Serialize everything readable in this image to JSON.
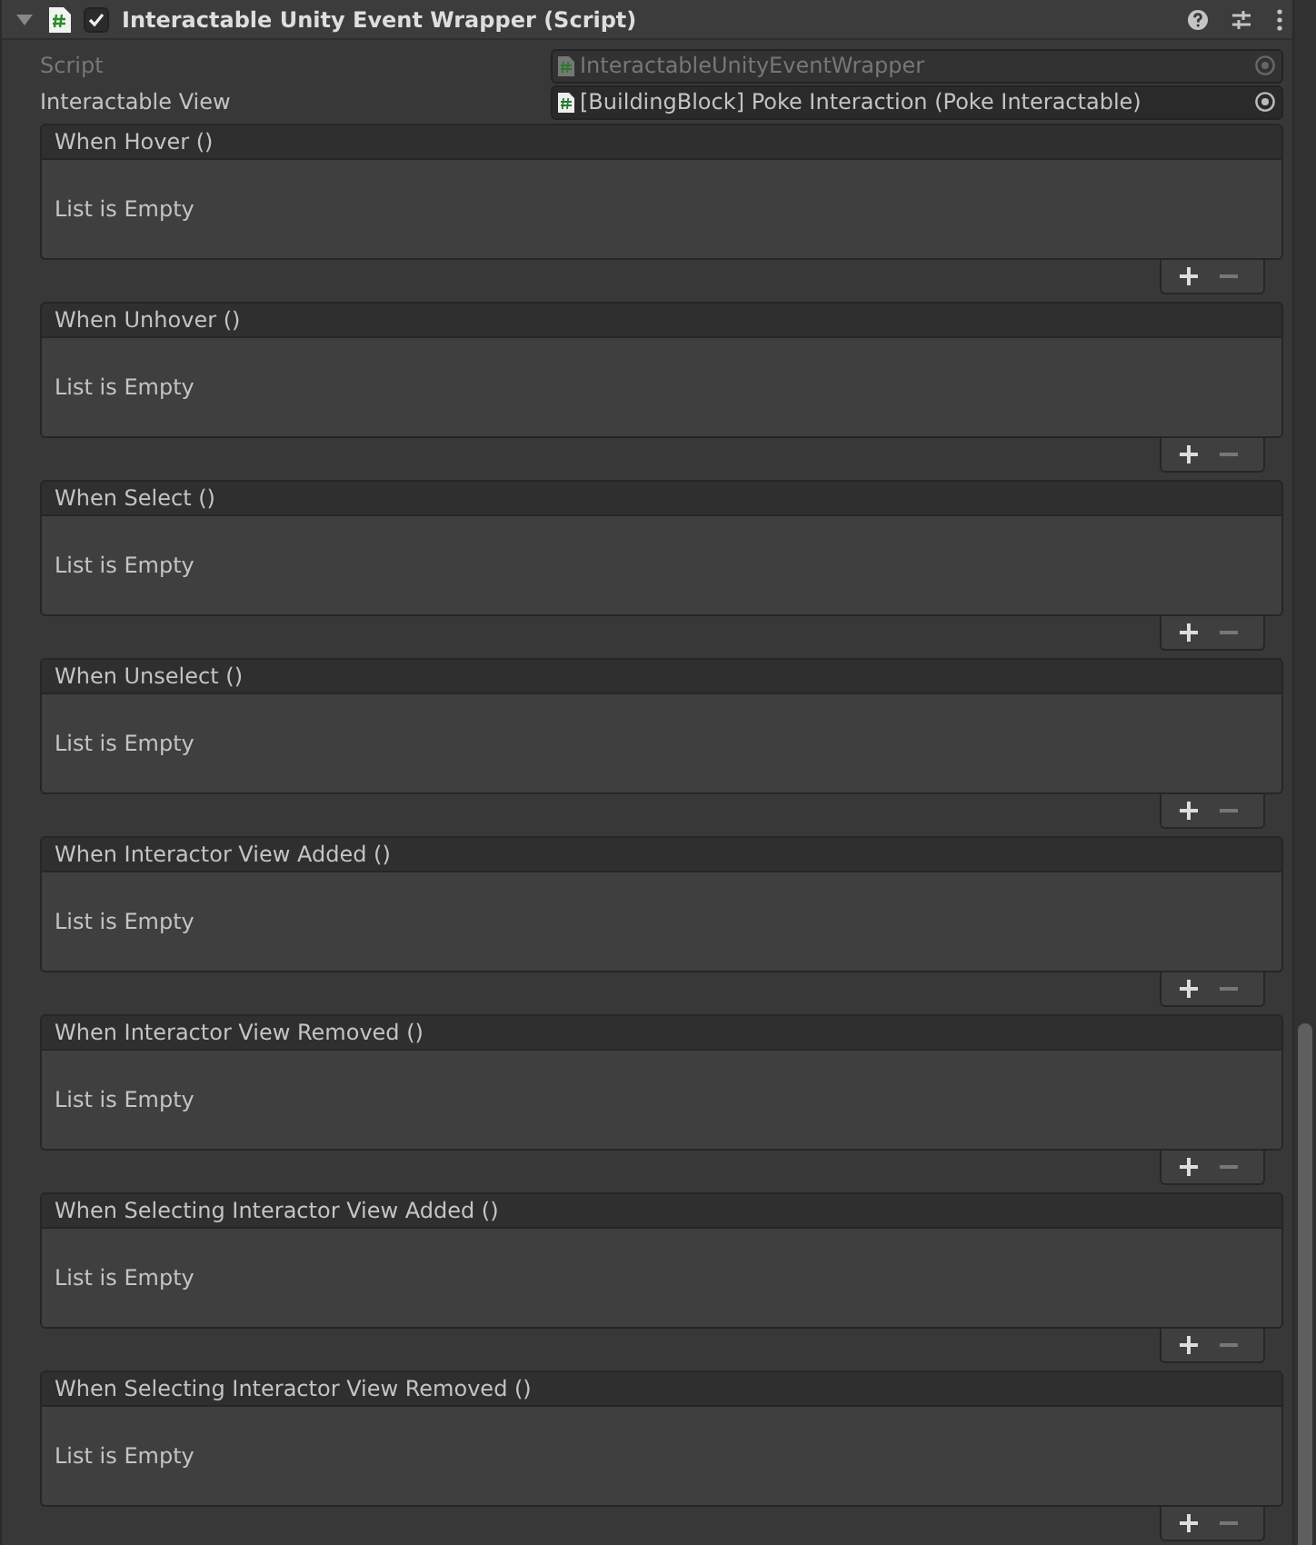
{
  "component": {
    "title": "Interactable Unity Event Wrapper (Script)",
    "expanded": true,
    "enabled": true
  },
  "fields": [
    {
      "label": "Script",
      "value": "InteractableUnityEventWrapper",
      "disabled": true
    },
    {
      "label": "Interactable View",
      "value": "[BuildingBlock] Poke Interaction (Poke Interactable)",
      "disabled": false
    }
  ],
  "events": [
    {
      "title": "When Hover ()",
      "empty_text": "List is Empty",
      "remove_disabled": true
    },
    {
      "title": "When Unhover ()",
      "empty_text": "List is Empty",
      "remove_disabled": true
    },
    {
      "title": "When Select ()",
      "empty_text": "List is Empty",
      "remove_disabled": true
    },
    {
      "title": "When Unselect ()",
      "empty_text": "List is Empty",
      "remove_disabled": true
    },
    {
      "title": "When Interactor View Added ()",
      "empty_text": "List is Empty",
      "remove_disabled": true
    },
    {
      "title": "When Interactor View Removed ()",
      "empty_text": "List is Empty",
      "remove_disabled": true
    },
    {
      "title": "When Selecting Interactor View Added ()",
      "empty_text": "List is Empty",
      "remove_disabled": true
    },
    {
      "title": "When Selecting Interactor View Removed ()",
      "empty_text": "List is Empty",
      "remove_disabled": true
    }
  ]
}
